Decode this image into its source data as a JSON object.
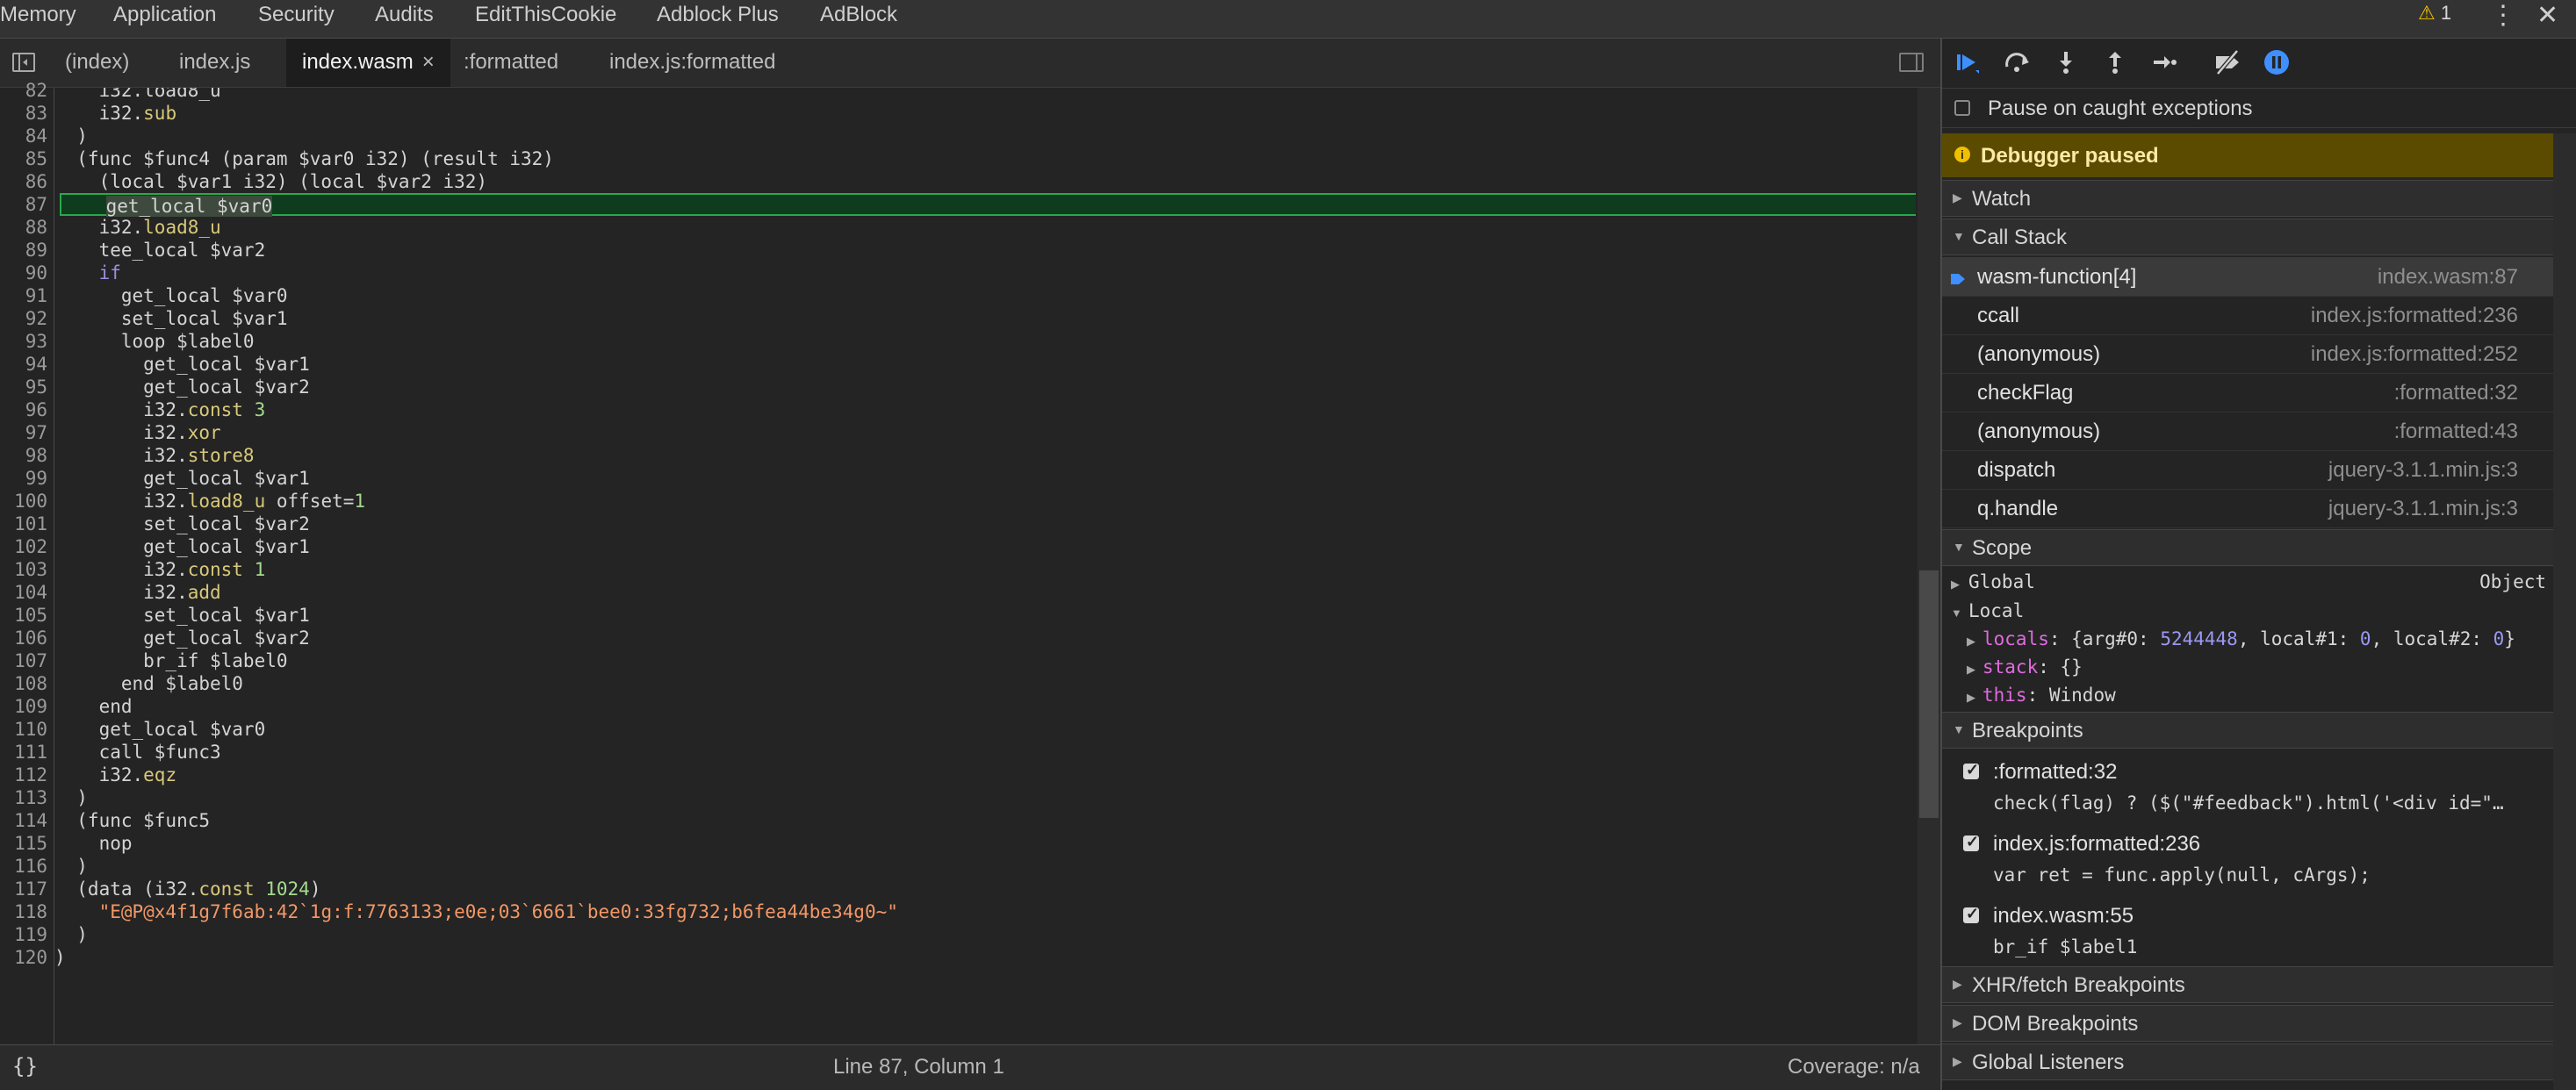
{
  "top_tabs": [
    "Memory",
    "Application",
    "Security",
    "Audits",
    "EditThisCookie",
    "Adblock Plus",
    "AdBlock"
  ],
  "top_right": {
    "warning_count": "1"
  },
  "file_tabs": [
    {
      "label": "(index)"
    },
    {
      "label": "index.js"
    },
    {
      "label": "index.wasm",
      "active": true
    },
    {
      "label": ":formatted"
    },
    {
      "label": "index.js:formatted"
    }
  ],
  "close_glyph": "×",
  "code": {
    "first_partial": "    i32.load8_u",
    "lines": [
      {
        "n": "83",
        "t": "    i32.sub"
      },
      {
        "n": "84",
        "t": "  )"
      },
      {
        "n": "85",
        "t": "  (func $func4 (param $var0 i32) (result i32)"
      },
      {
        "n": "86",
        "t": "    (local $var1 i32) (local $var2 i32)"
      },
      {
        "n": "87",
        "t": "    get_local $var0"
      },
      {
        "n": "88",
        "t": "    i32.load8_u"
      },
      {
        "n": "89",
        "t": "    tee_local $var2"
      },
      {
        "n": "90",
        "t": "    if"
      },
      {
        "n": "91",
        "t": "      get_local $var0"
      },
      {
        "n": "92",
        "t": "      set_local $var1"
      },
      {
        "n": "93",
        "t": "      loop $label0"
      },
      {
        "n": "94",
        "t": "        get_local $var1"
      },
      {
        "n": "95",
        "t": "        get_local $var2"
      },
      {
        "n": "96",
        "t": "        i32.const 3"
      },
      {
        "n": "97",
        "t": "        i32.xor"
      },
      {
        "n": "98",
        "t": "        i32.store8"
      },
      {
        "n": "99",
        "t": "        get_local $var1"
      },
      {
        "n": "100",
        "t": "        i32.load8_u offset=1"
      },
      {
        "n": "101",
        "t": "        set_local $var2"
      },
      {
        "n": "102",
        "t": "        get_local $var1"
      },
      {
        "n": "103",
        "t": "        i32.const 1"
      },
      {
        "n": "104",
        "t": "        i32.add"
      },
      {
        "n": "105",
        "t": "        set_local $var1"
      },
      {
        "n": "106",
        "t": "        get_local $var2"
      },
      {
        "n": "107",
        "t": "        br_if $label0"
      },
      {
        "n": "108",
        "t": "      end $label0"
      },
      {
        "n": "109",
        "t": "    end"
      },
      {
        "n": "110",
        "t": "    get_local $var0"
      },
      {
        "n": "111",
        "t": "    call $func3"
      },
      {
        "n": "112",
        "t": "    i32.eqz"
      },
      {
        "n": "113",
        "t": "  )"
      },
      {
        "n": "114",
        "t": "  (func $func5"
      },
      {
        "n": "115",
        "t": "    nop"
      },
      {
        "n": "116",
        "t": "  )"
      },
      {
        "n": "117",
        "t": "  (data (i32.const 1024)"
      },
      {
        "n": "118",
        "t": "    \"E@P@x4f1g7f6ab:42`1g:f:7763133;e0e;03`6661`bee0:33fg732;b6fea44be34g0~\""
      },
      {
        "n": "119",
        "t": "  )"
      },
      {
        "n": "120",
        "t": ")"
      }
    ],
    "execution_line": "87"
  },
  "status": {
    "braces": "{}",
    "position": "Line 87, Column 1",
    "coverage": "Coverage: n/a"
  },
  "sidebar": {
    "pause_on_caught": "Pause on caught exceptions",
    "paused_banner": "Debugger paused",
    "watch": "Watch",
    "call_stack": "Call Stack",
    "frames": [
      {
        "fn": "wasm-function[4]",
        "loc": "index.wasm:87",
        "current": true
      },
      {
        "fn": "ccall",
        "loc": "index.js:formatted:236"
      },
      {
        "fn": "(anonymous)",
        "loc": "index.js:formatted:252"
      },
      {
        "fn": "checkFlag",
        "loc": ":formatted:32"
      },
      {
        "fn": "(anonymous)",
        "loc": ":formatted:43"
      },
      {
        "fn": "dispatch",
        "loc": "jquery-3.1.1.min.js:3"
      },
      {
        "fn": "q.handle",
        "loc": "jquery-3.1.1.min.js:3"
      }
    ],
    "scope": "Scope",
    "scope_global": "Global",
    "scope_global_val": "Object",
    "scope_local": "Local",
    "locals_key": "locals",
    "locals_val": "{arg#0: 5244448, local#1: 0, local#2: 0}",
    "stack_key": "stack",
    "stack_val": "{}",
    "this_key": "this",
    "this_val": "Window",
    "breakpoints": "Breakpoints",
    "bps": [
      {
        "file": ":formatted:32",
        "code": "check(flag) ? ($(\"#feedback\").html('<div id=\"…"
      },
      {
        "file": "index.js:formatted:236",
        "code": "var ret = func.apply(null, cArgs);"
      },
      {
        "file": "index.wasm:55",
        "code": "br_if $label1"
      }
    ],
    "xhr": "XHR/fetch Breakpoints",
    "dom": "DOM Breakpoints",
    "global_listeners": "Global Listeners"
  },
  "colors": {
    "execution_line_bg": "#0f3b1f",
    "execution_line_border": "#29a84a",
    "paused_banner_bg": "#5a4b00",
    "accent_blue": "#3f8fff"
  }
}
